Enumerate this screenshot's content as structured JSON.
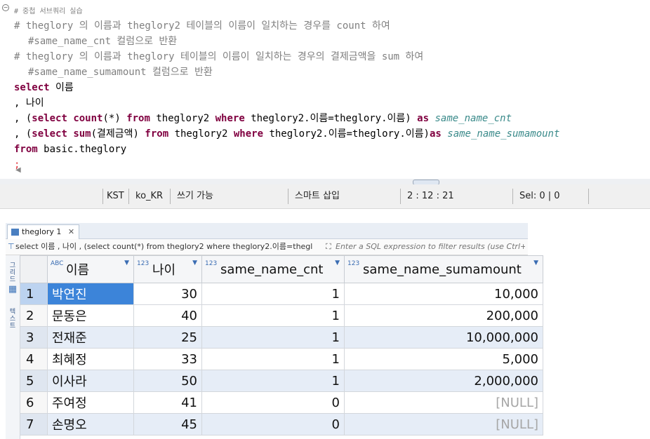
{
  "editor": {
    "lines": [
      "# 중첩 서브쿼리 실습",
      "# theglory 의 이름과 theglory2 테이블의 이름이 일치하는 경우를 count 하여",
      "#same_name_cnt 컬럼으로 반환",
      "# theglory 의 이름과 theglory 테이블의 이름이 일치하는 경우의 결제금액을 sum 하여",
      "#same_name_sumamount 컬럼으로 반환",
      "select 이름",
      ", 나이",
      ", (select count(*) from theglory2 where theglory2.이름=theglory.이름) as same_name_cnt",
      ", (select sum(결제금액) from theglory2 where theglory2.이름=theglory.이름)as same_name_sumamount",
      "from basic.theglory",
      ";"
    ]
  },
  "statusbar": {
    "timezone": "KST",
    "locale": "ko_KR",
    "write_mode": "쓰기 가능",
    "insert_mode": "스마트 삽입",
    "position": "2 : 12 : 21",
    "selection": "Sel: 0 | 0"
  },
  "results": {
    "tab_label": "theglory 1",
    "tab_close": "✕",
    "query_preview": "select 이름 , 나이 , (select count(*) from theglory2 where theglory2.이름=thegl",
    "filter_placeholder": "Enter a SQL expression to filter results (use Ctrl+Space)",
    "side_tabs": [
      "그리드",
      "텍스트"
    ],
    "columns": [
      {
        "type": "ABC",
        "name": "이름"
      },
      {
        "type": "123",
        "name": "나이"
      },
      {
        "type": "123",
        "name": "same_name_cnt"
      },
      {
        "type": "123",
        "name": "same_name_sumamount"
      }
    ],
    "rows": [
      {
        "rn": "1",
        "name": "박연진",
        "age": "30",
        "cnt": "1",
        "sum": "10,000"
      },
      {
        "rn": "2",
        "name": "문동은",
        "age": "40",
        "cnt": "1",
        "sum": "200,000"
      },
      {
        "rn": "3",
        "name": "전재준",
        "age": "25",
        "cnt": "1",
        "sum": "10,000,000"
      },
      {
        "rn": "4",
        "name": "최혜정",
        "age": "33",
        "cnt": "1",
        "sum": "5,000"
      },
      {
        "rn": "5",
        "name": "이사라",
        "age": "50",
        "cnt": "1",
        "sum": "2,000,000"
      },
      {
        "rn": "6",
        "name": "주여정",
        "age": "41",
        "cnt": "0",
        "sum": "[NULL]"
      },
      {
        "rn": "7",
        "name": "손명오",
        "age": "45",
        "cnt": "0",
        "sum": "[NULL]"
      }
    ]
  },
  "colors": {
    "keyword": "#800040",
    "table_name": "#e0303a",
    "alias": "#3a8a8a",
    "comment": "#808080",
    "selection": "#3c84d9"
  }
}
